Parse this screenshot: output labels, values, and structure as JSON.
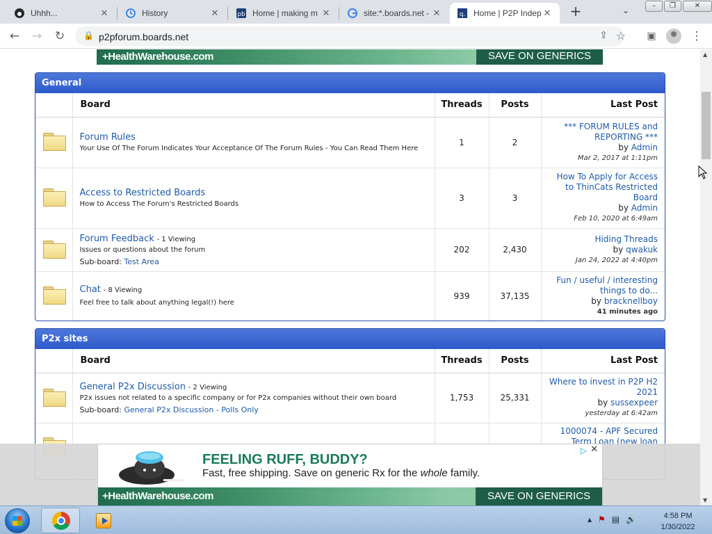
{
  "browser": {
    "tabs": [
      {
        "title": "Uhhh...",
        "favicon": "github-icon",
        "active": false
      },
      {
        "title": "History",
        "favicon": "history-icon",
        "active": false
      },
      {
        "title": "Home | making m",
        "favicon": "proboards-icon",
        "active": false
      },
      {
        "title": "site:*.boards.net -",
        "favicon": "google-icon",
        "active": false
      },
      {
        "title": "Home | P2P Indep",
        "favicon": "p2p-icon",
        "active": true
      }
    ],
    "url": "p2pforum.boards.net"
  },
  "ads": {
    "top_brand": "+HealthWarehouse.com",
    "top_cta": "SAVE ON GENERICS",
    "bottom_headline": "FEELING RUFF, BUDDY?",
    "bottom_sub_pre": "Fast, free shipping. Save on generic Rx for the ",
    "bottom_sub_em": "whole",
    "bottom_sub_post": " family.",
    "bottom_brand": "+HealthWarehouse.com",
    "bottom_cta": "SAVE ON GENERICS",
    "colors": {
      "brand_green": "#1b7a5a",
      "strip_dark": "#1e5e48"
    }
  },
  "columns": {
    "board": "Board",
    "threads": "Threads",
    "posts": "Posts",
    "last_post": "Last Post"
  },
  "categories": [
    {
      "title": "General",
      "boards": [
        {
          "name": "Forum Rules",
          "viewing": "",
          "description": "Your Use Of The Forum Indicates Your Acceptance Of The Forum Rules - You Can Read Them Here",
          "subboard_label": "",
          "subboard": "",
          "threads": "1",
          "posts": "2",
          "last_title": "*** FORUM RULES and REPORTING ***",
          "last_by_label": "by",
          "last_by": "Admin",
          "last_date": "Mar 2, 2017 at 1:11pm"
        },
        {
          "name": "Access to Restricted Boards",
          "viewing": "",
          "description": "How to Access The Forum's Restricted Boards",
          "subboard_label": "",
          "subboard": "",
          "threads": "3",
          "posts": "3",
          "last_title": "How To Apply for Access to ThinCats Restricted Board",
          "last_by_label": "by",
          "last_by": "Admin",
          "last_date": "Feb 10, 2020 at 6:49am"
        },
        {
          "name": "Forum Feedback",
          "viewing": "- 1 Viewing",
          "description": "Issues or questions about the forum",
          "subboard_label": "Sub-board:",
          "subboard": "Test Area",
          "threads": "202",
          "posts": "2,430",
          "last_title": "Hiding Threads",
          "last_by_label": "by",
          "last_by": "qwakuk",
          "last_date": "Jan 24, 2022 at 4:40pm"
        },
        {
          "name": "Chat",
          "viewing": "- 8 Viewing",
          "description": "Feel free to talk about anything legal(!) here",
          "subboard_label": "",
          "subboard": "",
          "threads": "939",
          "posts": "37,135",
          "last_title": "Fun / useful / interesting things to do...",
          "last_by_label": "by",
          "last_by": "bracknellboy",
          "last_date": "41 minutes ago"
        }
      ]
    },
    {
      "title": "P2x sites",
      "boards": [
        {
          "name": "General P2x Discussion",
          "viewing": "- 2 Viewing",
          "description": "P2x issues not related to a specific company or for P2x companies without their own board",
          "subboard_label": "Sub-board:",
          "subboard": "General P2x Discussion - Polls Only",
          "threads": "1,753",
          "posts": "25,331",
          "last_title": "Where to invest in P2P H2 2021",
          "last_by_label": "by",
          "last_by": "sussexpeer",
          "last_date": "yesterday at 6:42am"
        },
        {
          "name": "",
          "viewing": "",
          "description": "",
          "subboard_label": "",
          "subboard": "",
          "threads": "",
          "posts": "",
          "last_title": "1000074 - APF Secured Term Loan (new loan",
          "last_by_label": "",
          "last_by": "",
          "last_date": ""
        }
      ]
    }
  ],
  "taskbar": {
    "time": "4:58 PM",
    "date": "1/30/2022"
  }
}
